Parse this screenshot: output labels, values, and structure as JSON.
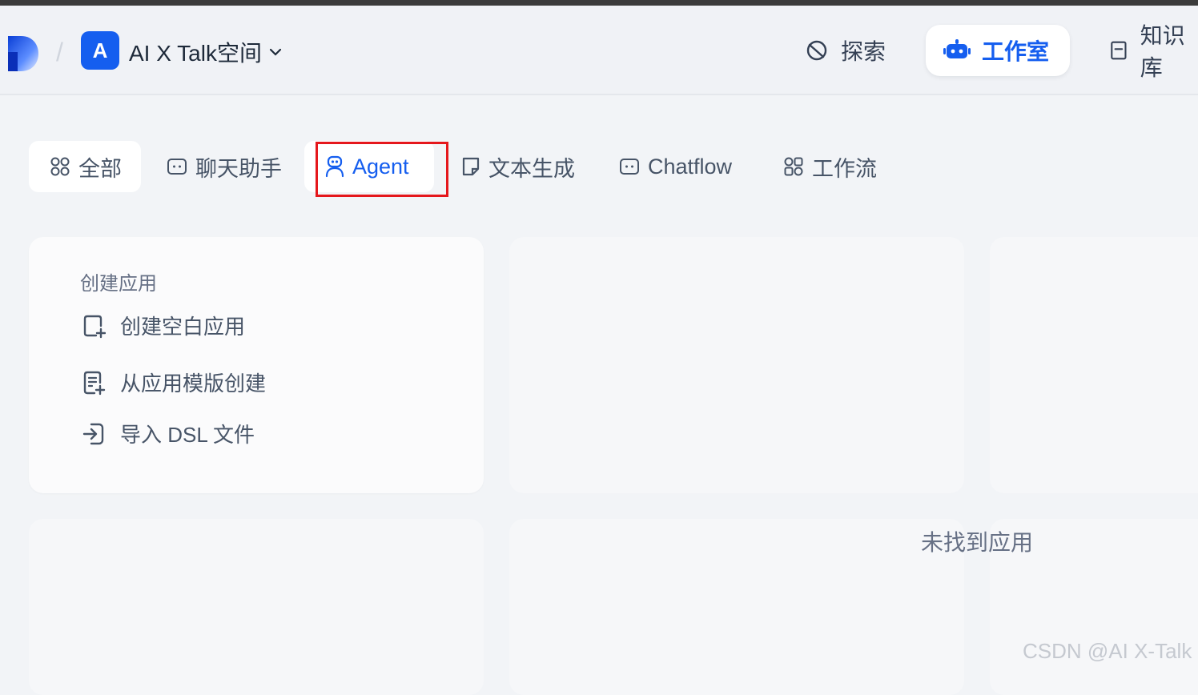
{
  "header": {
    "workspace_initial": "A",
    "workspace_name": "AI X Talk空间",
    "breadcrumb_separator": "/",
    "nav": {
      "explore": "探索",
      "studio": "工作室",
      "knowledge": "知识库"
    }
  },
  "tabs": [
    {
      "label": "全部",
      "icon": "grid-icon"
    },
    {
      "label": "聊天助手",
      "icon": "chat-bubble-icon"
    },
    {
      "label": "Agent",
      "icon": "robot-icon"
    },
    {
      "label": "文本生成",
      "icon": "document-icon"
    },
    {
      "label": "Chatflow",
      "icon": "chat-bubble-icon"
    },
    {
      "label": "工作流",
      "icon": "workflow-icon"
    }
  ],
  "create_card": {
    "title": "创建应用",
    "items": [
      {
        "label": "创建空白应用",
        "icon": "blank-file-plus-icon"
      },
      {
        "label": "从应用模版创建",
        "icon": "template-icon"
      },
      {
        "label": "导入 DSL 文件",
        "icon": "import-icon"
      }
    ]
  },
  "empty_state": "未找到应用",
  "watermark": "CSDN @AI X-Talk",
  "colors": {
    "accent": "#155eef",
    "highlight": "#e5171c",
    "background": "#f2f4f7"
  }
}
